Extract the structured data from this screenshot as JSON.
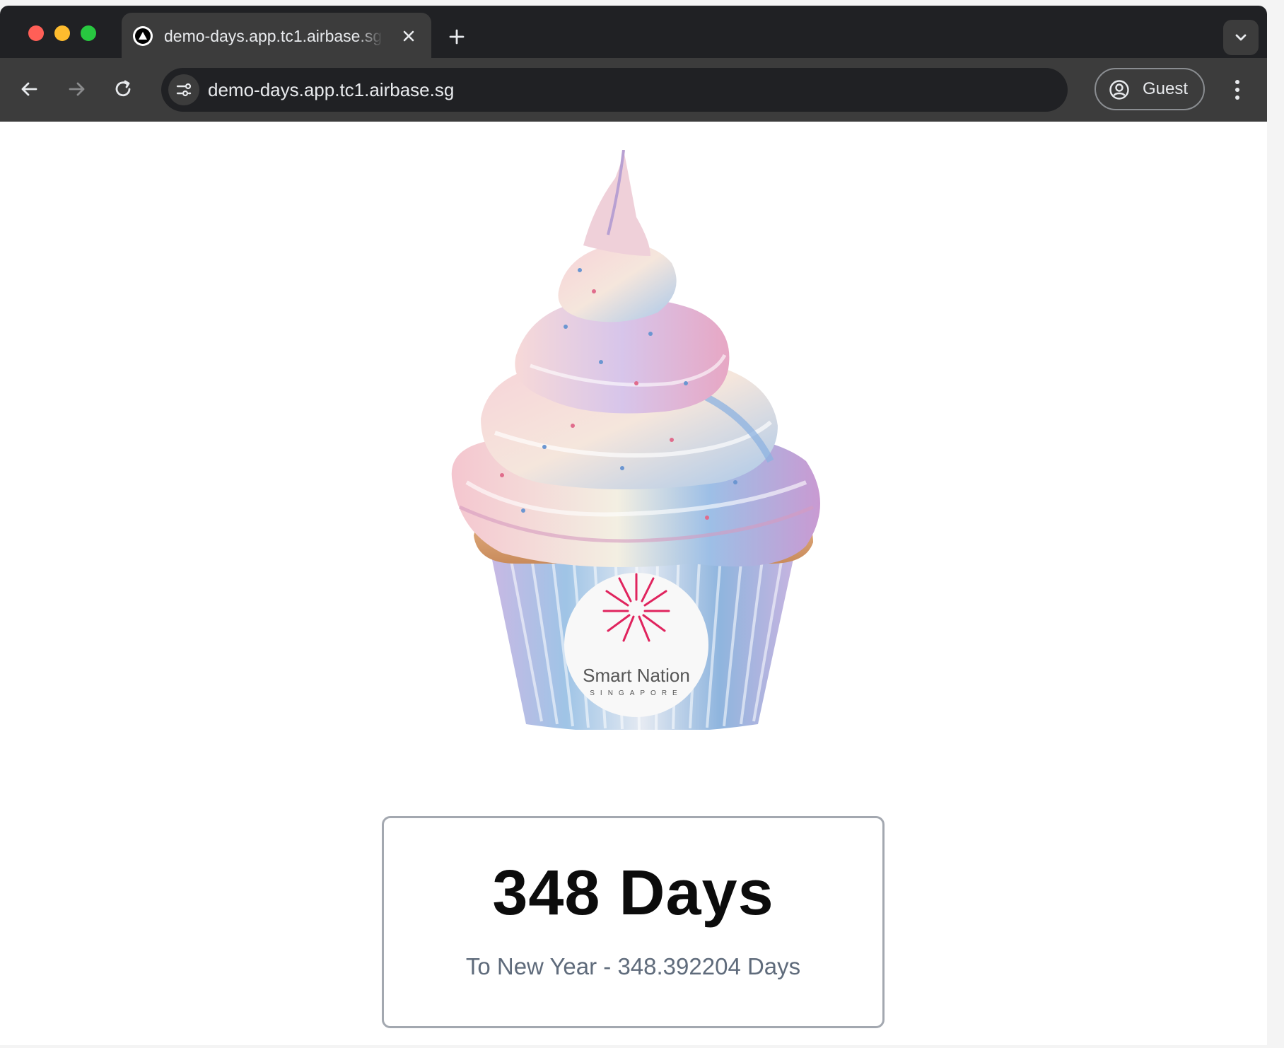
{
  "browser": {
    "tab": {
      "title": "demo-days.app.tc1.airbase.sg",
      "favicon": "triangle-logo-icon",
      "close_icon": "close-icon"
    },
    "new_tab_icon": "plus-icon",
    "tab_search_icon": "chevron-down-icon",
    "nav": {
      "back_icon": "arrow-left-icon",
      "forward_icon": "arrow-right-icon",
      "reload_icon": "reload-icon"
    },
    "address_bar": {
      "site_info_icon": "tune-icon",
      "url": "demo-days.app.tc1.airbase.sg"
    },
    "profile": {
      "icon": "account-circle-icon",
      "label": "Guest"
    },
    "menu_icon": "more-vertical-icon"
  },
  "page": {
    "image": {
      "subject": "cupcake",
      "badge_text": "Smart Nation",
      "badge_subtext": "SINGAPORE"
    },
    "counter": {
      "headline": "348 Days",
      "detail": "To New Year - 348.392204 Days"
    }
  },
  "colors": {
    "browser_dark": "#202124",
    "toolbar": "#3c3c3c",
    "accent_pink": "#e0245e",
    "card_border": "#a3a8b0",
    "subtext": "#5f6b7b"
  }
}
